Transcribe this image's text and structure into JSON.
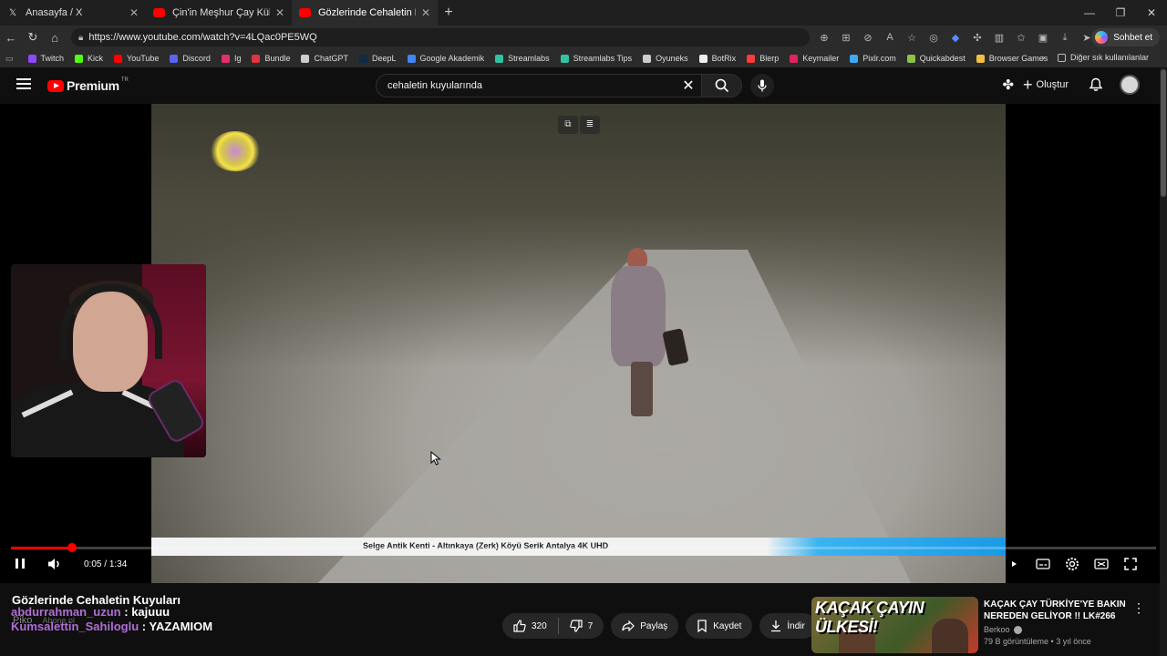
{
  "browser": {
    "tabs": [
      {
        "title": "Anasayfa / X",
        "favicon": "x-logo-icon"
      },
      {
        "title": "Çin'in Meşhur Çay Kültürü - Çin'de",
        "favicon": "youtube-icon"
      },
      {
        "title": "Gözlerinde Cehaletin Kuyuları",
        "favicon": "youtube-icon",
        "active": true
      }
    ],
    "url": "https://www.youtube.com/watch?v=4LQac0PE5WQ",
    "chat_button": "Sohbet et",
    "bookmarks": [
      {
        "label": "Twitch",
        "color": "#9146ff"
      },
      {
        "label": "Kick",
        "color": "#53fc18"
      },
      {
        "label": "YouTube",
        "color": "#ff0000"
      },
      {
        "label": "Discord",
        "color": "#5865f2"
      },
      {
        "label": "Ig",
        "color": "#e1306c"
      },
      {
        "label": "Bundle",
        "color": "#e2343f"
      },
      {
        "label": "ChatGPT",
        "color": "#cccccc"
      },
      {
        "label": "DeepL",
        "color": "#0f2b46"
      },
      {
        "label": "Google Akademik",
        "color": "#4285f4"
      },
      {
        "label": "Streamlabs",
        "color": "#31c3a2"
      },
      {
        "label": "Streamlabs Tips",
        "color": "#31c3a2"
      },
      {
        "label": "Oyuneks",
        "color": "#cccccc"
      },
      {
        "label": "BotRix",
        "color": "#eeeeee"
      },
      {
        "label": "Blerp",
        "color": "#ff3b3b"
      },
      {
        "label": "Keymailer",
        "color": "#e0245e"
      },
      {
        "label": "Pixlr.com",
        "color": "#3da9f5"
      },
      {
        "label": "Quickabdest",
        "color": "#8bc34a"
      },
      {
        "label": "Browser Games",
        "color": "#f0c040"
      }
    ],
    "other_bookmarks": "Diğer sık kullanılanlar"
  },
  "youtube": {
    "logo_text": "Premium",
    "logo_region": "TR",
    "search_query": "cehaletin kuyularında",
    "create_label": "Oluştur",
    "video": {
      "overlay_caption": "Selge Antik Kenti - Altınkaya (Zerk) Köyü Serik Antalya 4K UHD",
      "time_current": "0:05",
      "time_total": "1:34",
      "progress": 0.0532
    },
    "title": "Gözlerinde Cehaletin Kuyuları",
    "channel_ghost": "Piko",
    "subscribe_ghost": "Abone ol",
    "likes": "320",
    "dislikes": "7",
    "share_label": "Paylaş",
    "save_label": "Kaydet",
    "download_label": "İndir",
    "recommended": {
      "thumb_text": "KAÇAK ÇAYIN ÜLKESİ!",
      "title": "KAÇAK ÇAY TÜRKİYE'YE BAKIN NEREDEN GELİYOR !! LK#266",
      "channel": "Berkoo",
      "meta": "79 B görüntüleme • 3 yıl önce"
    }
  },
  "stream_chat": [
    {
      "user": "abdurrahman_uzun",
      "message": "kajuuu"
    },
    {
      "user": "Kumsalettin_Sahiloglu",
      "message": "YAZAMIOM"
    }
  ]
}
